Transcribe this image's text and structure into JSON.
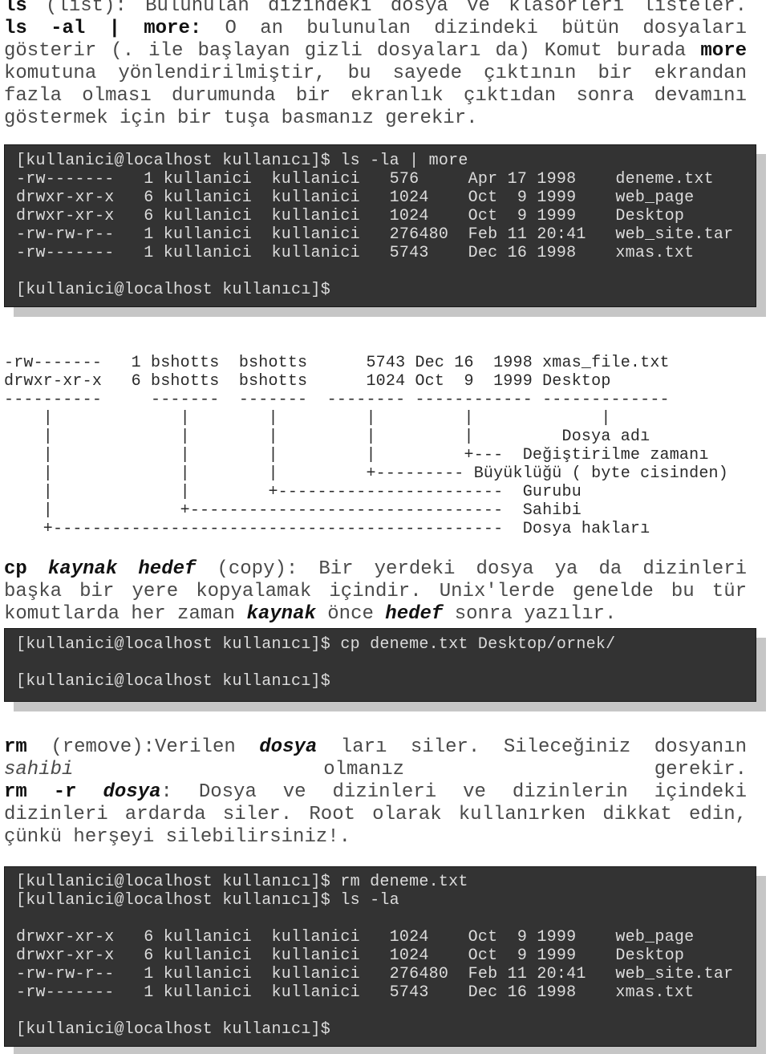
{
  "paragraphs": [
    {
      "name": "ls-description",
      "lines": [
        [
          [
            "ls",
            "b"
          ],
          [
            " (list): Bulunulan dizindeki dosya ve klasörleri listeler.",
            ""
          ]
        ],
        [
          [
            "ls -al | more:",
            "b"
          ],
          [
            " O an bulunulan dizindeki bütün dosyaları",
            ""
          ]
        ],
        [
          [
            "gösterir (. ile başlayan gizli dosyaları da) Komut burada ",
            ""
          ],
          [
            "more",
            "b"
          ]
        ],
        [
          [
            "komutuna yönlendirilmiştir, bu sayede çıktının bir ekrandan",
            ""
          ]
        ],
        [
          [
            "fazla olması durumunda bir ekranlık çıktıdan sonra devamını",
            ""
          ]
        ],
        [
          [
            "göstermek için bir tuşa basmanız gerekir.",
            ""
          ]
        ]
      ]
    },
    {
      "name": "cp-description",
      "lines": [
        [
          [
            "cp",
            "b"
          ],
          [
            " ",
            ""
          ],
          [
            "kaynak",
            "bi"
          ],
          [
            " ",
            ""
          ],
          [
            "hedef",
            "bi"
          ],
          [
            " (copy): Bir yerdeki dosya ya da dizinleri",
            ""
          ]
        ],
        [
          [
            "başka bir yere kopyalamak içindir. Unix'lerde genelde bu tür",
            ""
          ]
        ],
        [
          [
            "komutlarda her zaman ",
            ""
          ],
          [
            "kaynak",
            "bi"
          ],
          [
            " önce ",
            ""
          ],
          [
            "hedef",
            "bi"
          ],
          [
            " sonra yazılır.",
            ""
          ]
        ]
      ]
    },
    {
      "name": "rm-description",
      "lines": [
        [
          [
            "rm",
            "b"
          ],
          [
            " (remove):Verilen ",
            ""
          ],
          [
            "dosya",
            "bi"
          ],
          [
            " ları siler. Sileceğiniz dosyanın",
            ""
          ]
        ],
        [
          [
            "sahibi",
            "i"
          ],
          [
            " olmanız gerekir.",
            ""
          ]
        ],
        [
          [
            "rm -r",
            "b"
          ],
          [
            " ",
            ""
          ],
          [
            "dosya",
            "bi"
          ],
          [
            ": Dosya ve dizinleri ve dizinlerin içindeki",
            ""
          ]
        ],
        [
          [
            "dizinleri ardarda siler. Root olarak kullanırken dikkat edin,",
            ""
          ]
        ],
        [
          [
            "çünkü herşeyi silebilirsiniz!.",
            ""
          ]
        ]
      ]
    }
  ],
  "terminals": [
    {
      "name": "terminal-ls-la",
      "lines": [
        "[kullanici@localhost kullanıcı]$ ls -la | more",
        "-rw-------   1 kullanici  kullanici   576     Apr 17 1998    deneme.txt",
        "drwxr-xr-x   6 kullanici  kullanici   1024    Oct  9 1999    web_page",
        "drwxr-xr-x   6 kullanici  kullanici   1024    Oct  9 1999    Desktop",
        "-rw-rw-r--   1 kullanici  kullanici   276480  Feb 11 20:41   web_site.tar",
        "-rw-------   1 kullanici  kullanici   5743    Dec 16 1998    xmas.txt",
        "",
        "[kullanici@localhost kullanıcı]$"
      ]
    },
    {
      "name": "terminal-cp",
      "lines": [
        "[kullanici@localhost kullanıcı]$ cp deneme.txt Desktop/ornek/",
        "",
        "[kullanici@localhost kullanıcı]$"
      ]
    },
    {
      "name": "terminal-rm",
      "lines": [
        "[kullanici@localhost kullanıcı]$ rm deneme.txt",
        "[kullanici@localhost kullanıcı]$ ls -la",
        "",
        "drwxr-xr-x   6 kullanici  kullanici   1024    Oct  9 1999    web_page",
        "drwxr-xr-x   6 kullanici  kullanici   1024    Oct  9 1999    Desktop",
        "-rw-rw-r--   1 kullanici  kullanici   276480  Feb 11 20:41   web_site.tar",
        "-rw-------   1 kullanici  kullanici   5743    Dec 16 1998    xmas.txt",
        "",
        "[kullanici@localhost kullanıcı]$"
      ]
    }
  ],
  "diagram": {
    "lines": [
      "-rw-------   1 bshotts  bshotts      5743 Dec 16  1998 xmas_file.txt",
      "drwxr-xr-x   6 bshotts  bshotts      1024 Oct  9  1999 Desktop",
      "----------     -------  -------  -------- ------------ -------------",
      "    |             |        |         |         |             |",
      "    |             |        |         |         |         Dosya adı",
      "    |             |        |         |         +---  Değiştirilme zamanı",
      "    |             |        |         +--------- Büyüklüğü ( byte cisinden)",
      "    |             |        +-----------------------  Gurubu",
      "    |             +--------------------------------  Sahibi",
      "    +----------------------------------------------  Dosya hakları"
    ]
  }
}
